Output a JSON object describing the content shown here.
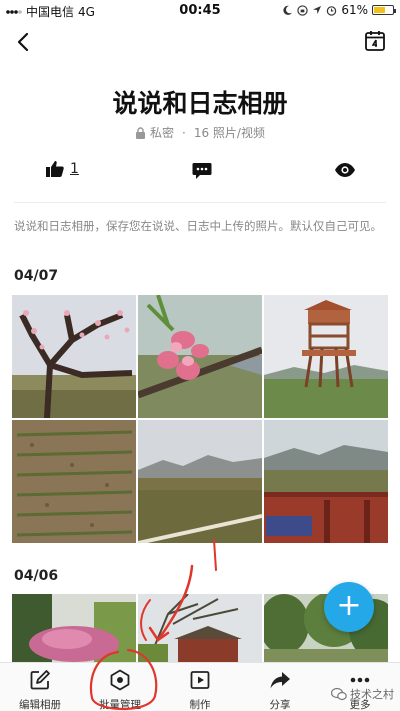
{
  "status_bar": {
    "carrier": "中国电信",
    "network": "4G",
    "time": "00:45",
    "battery_percent": "61%",
    "battery_level": 0.61
  },
  "album": {
    "title": "说说和日志相册",
    "privacy": "私密",
    "separator": "·",
    "count": "16 照片/视频",
    "description": "说说和日志相册，保存您在说说、日志中上传的照片。默认仅自己可见。"
  },
  "actions": {
    "like_count": "1"
  },
  "sections": [
    {
      "date": "04/07"
    },
    {
      "date": "04/06"
    }
  ],
  "fab": {
    "label": "+"
  },
  "toolbar": {
    "items": [
      {
        "label": "编辑相册",
        "icon": "edit-icon"
      },
      {
        "label": "批量管理",
        "icon": "batch-manage-icon"
      },
      {
        "label": "制作",
        "icon": "make-video-icon"
      },
      {
        "label": "分享",
        "icon": "share-icon"
      },
      {
        "label": "更多",
        "icon": "more-icon"
      }
    ]
  },
  "watermark": {
    "text": "技术之村"
  },
  "colors": {
    "accent": "#25a8e8",
    "annotation": "#e0362c",
    "battery": "#f2c21b"
  }
}
